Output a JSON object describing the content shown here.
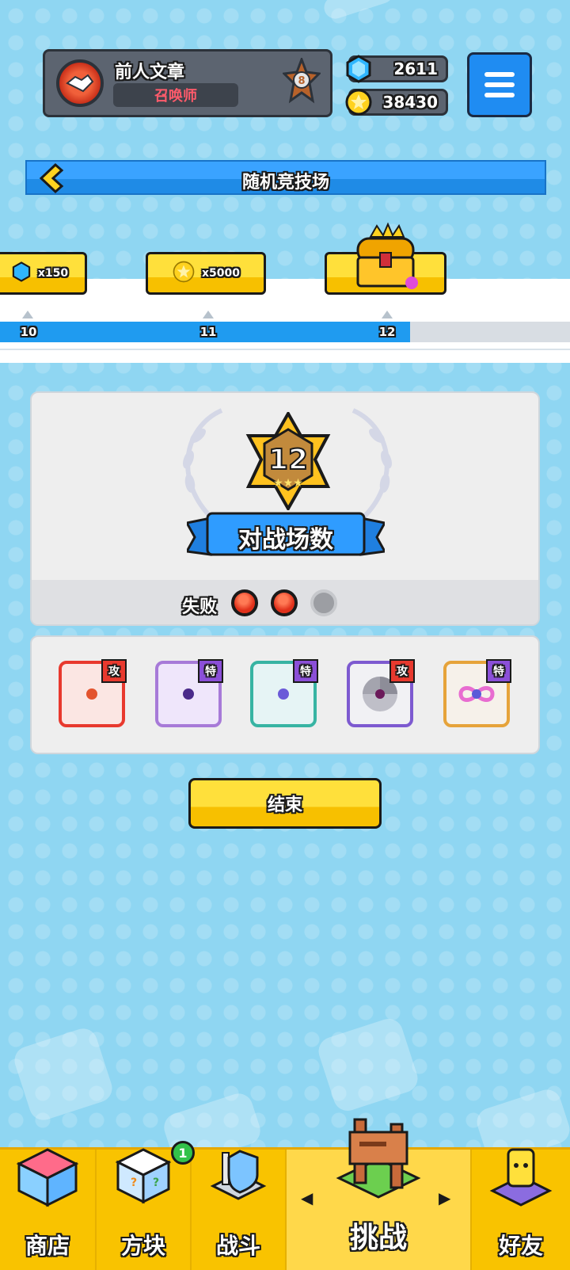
{
  "profile": {
    "name": "前人文章",
    "title": "召唤师",
    "rank": "8"
  },
  "currency": {
    "gems": "2611",
    "gold": "38430"
  },
  "page_title": "随机竞技场",
  "track": {
    "rewards": [
      {
        "amount": "x150",
        "kind": "gem"
      },
      {
        "amount": "x5000",
        "kind": "gold"
      },
      {
        "amount": "",
        "kind": "crown-chest"
      }
    ],
    "milestones": [
      "10",
      "11",
      "12"
    ],
    "progress_fraction": 0.72
  },
  "battle": {
    "count": "12",
    "label": "对战场数",
    "lose_label": "失败",
    "losses": 2,
    "max_losses": 3
  },
  "deck": [
    {
      "tag": "攻",
      "color": "#e8392e"
    },
    {
      "tag": "特",
      "color": "#a77ad8"
    },
    {
      "tag": "特",
      "color": "#37b4a3"
    },
    {
      "tag": "攻",
      "color": "#7d5ad0"
    },
    {
      "tag": "特",
      "color": "#e6a33a"
    }
  ],
  "end_button": "结束",
  "nav": {
    "shop": "商店",
    "dice": "方块",
    "battle": "战斗",
    "challenge": "挑战",
    "friends": "好友",
    "dice_badge": "1"
  }
}
